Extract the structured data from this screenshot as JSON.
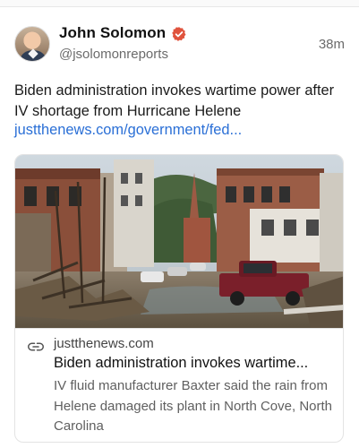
{
  "author": {
    "name": "John Solomon",
    "handle": "@jsolomonreports",
    "timestamp": "38m",
    "verified_color": "#e0533d"
  },
  "post": {
    "text": "Biden administration invokes wartime power after IV shortage from Hurricane Helene",
    "link": "justthenews.com/government/fed..."
  },
  "link_card": {
    "domain": "justthenews.com",
    "title": "Biden administration invokes wartime...",
    "description": "IV fluid manufacturer Baxter said the rain from Helene damaged its plant in North Cove, North Carolina",
    "icon": "link-icon"
  },
  "colors": {
    "link": "#2a6fd6",
    "text_secondary": "#6b6b6b"
  }
}
